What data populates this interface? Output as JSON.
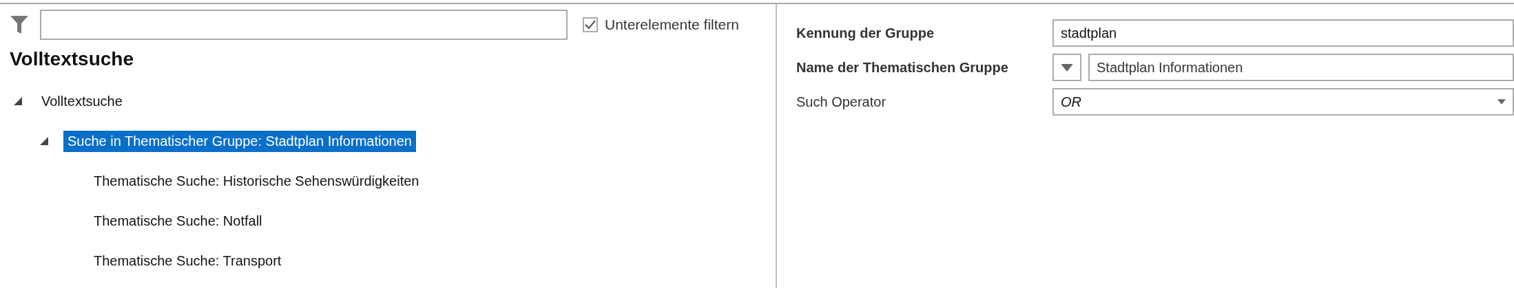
{
  "filter": {
    "checkbox": {
      "label": "Unterelemente filtern",
      "checked": true
    }
  },
  "title": "Volltextsuche",
  "tree": [
    {
      "label": "Volltextsuche",
      "expanded": true,
      "selected": false,
      "children": [
        {
          "label": "Suche in Thematischer Gruppe: Stadtplan Informationen",
          "expanded": true,
          "selected": true,
          "children": [
            {
              "label": "Thematische Suche: Historische Sehenswürdigkeiten",
              "selected": false
            },
            {
              "label": "Thematische Suche: Notfall",
              "selected": false
            },
            {
              "label": "Thematische Suche: Transport",
              "selected": false
            }
          ]
        }
      ]
    }
  ],
  "properties": [
    {
      "kind": "text",
      "label": "Kennung der Gruppe",
      "bold": true,
      "value": "stadtplan"
    },
    {
      "kind": "lookup",
      "label": "Name der Thematischen Gruppe",
      "bold": true,
      "value": "Stadtplan Informationen"
    },
    {
      "kind": "combo",
      "label": "Such Operator",
      "bold": false,
      "value": "OR"
    }
  ]
}
